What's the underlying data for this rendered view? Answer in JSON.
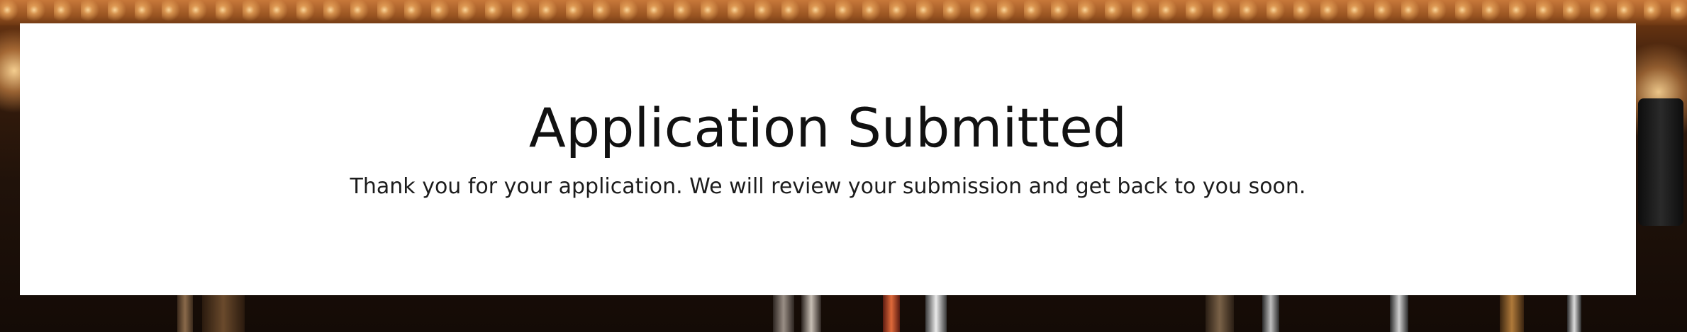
{
  "background": {
    "description_icon": "bar-lights-photo",
    "accent_color": "#c7783a"
  },
  "card": {
    "title": "Application Submitted",
    "message": "Thank you for your application. We will review your submission and get back to you soon."
  }
}
